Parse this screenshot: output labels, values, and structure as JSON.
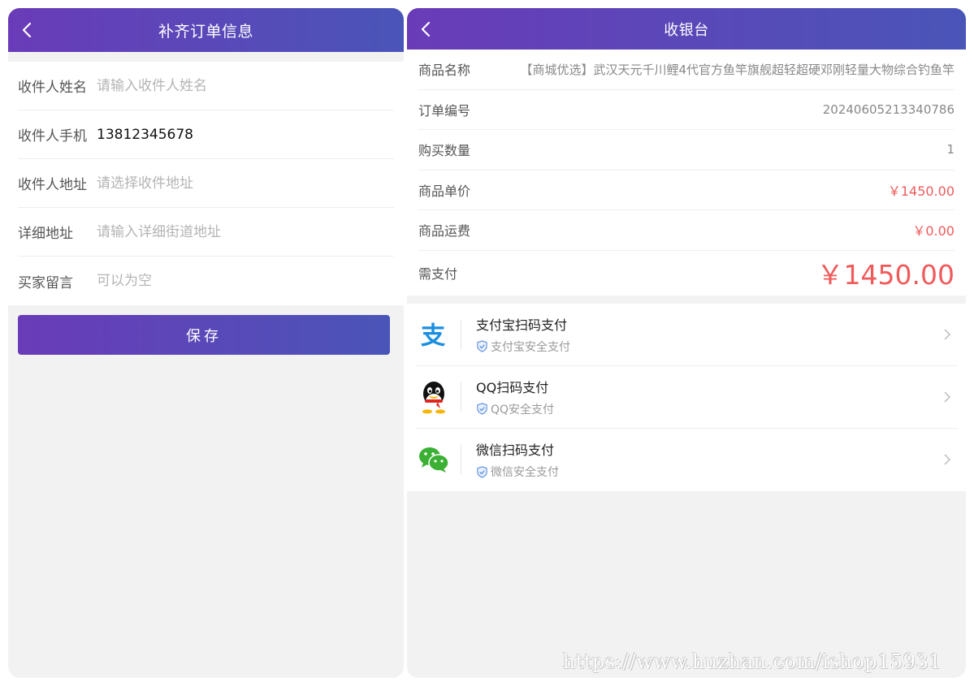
{
  "left": {
    "title": "补齐订单信息",
    "fields": [
      {
        "label": "收件人姓名",
        "value": "",
        "placeholder": "请输入收件人姓名"
      },
      {
        "label": "收件人手机",
        "value": "13812345678",
        "placeholder": ""
      },
      {
        "label": "收件人地址",
        "value": "",
        "placeholder": "请选择收件地址"
      },
      {
        "label": "详细地址",
        "value": "",
        "placeholder": "请输入详细街道地址"
      },
      {
        "label": "买家留言",
        "value": "",
        "placeholder": "可以为空"
      }
    ],
    "save_label": "保存"
  },
  "right": {
    "title": "收银台",
    "info": [
      {
        "label": "商品名称",
        "value": "【商城优选】武汉天元千川鲤4代官方鱼竿旗舰超轻超硬邓刚轻量大物综合钓鱼竿"
      },
      {
        "label": "订单编号",
        "value": "20240605213340786"
      },
      {
        "label": "购买数量",
        "value": "1"
      },
      {
        "label": "商品单价",
        "value": "￥1450.00"
      },
      {
        "label": "商品运费",
        "value": "￥0.00"
      },
      {
        "label": "需支付",
        "value": "￥1450.00"
      }
    ],
    "payments": [
      {
        "name": "支付宝扫码支付",
        "sub": "支付宝安全支付",
        "icon": "alipay-icon"
      },
      {
        "name": "QQ扫码支付",
        "sub": "QQ安全支付",
        "icon": "qq-icon"
      },
      {
        "name": "微信扫码支付",
        "sub": "微信安全支付",
        "icon": "wechat-icon"
      }
    ]
  },
  "watermark": "https://www.huzhan.com/ishop15931",
  "colors": {
    "header_start": "#6a3bb8",
    "header_end": "#4a55b8",
    "price_red": "#f05a5a",
    "alipay_blue": "#1a8fe0",
    "wechat_green": "#3cb034"
  }
}
